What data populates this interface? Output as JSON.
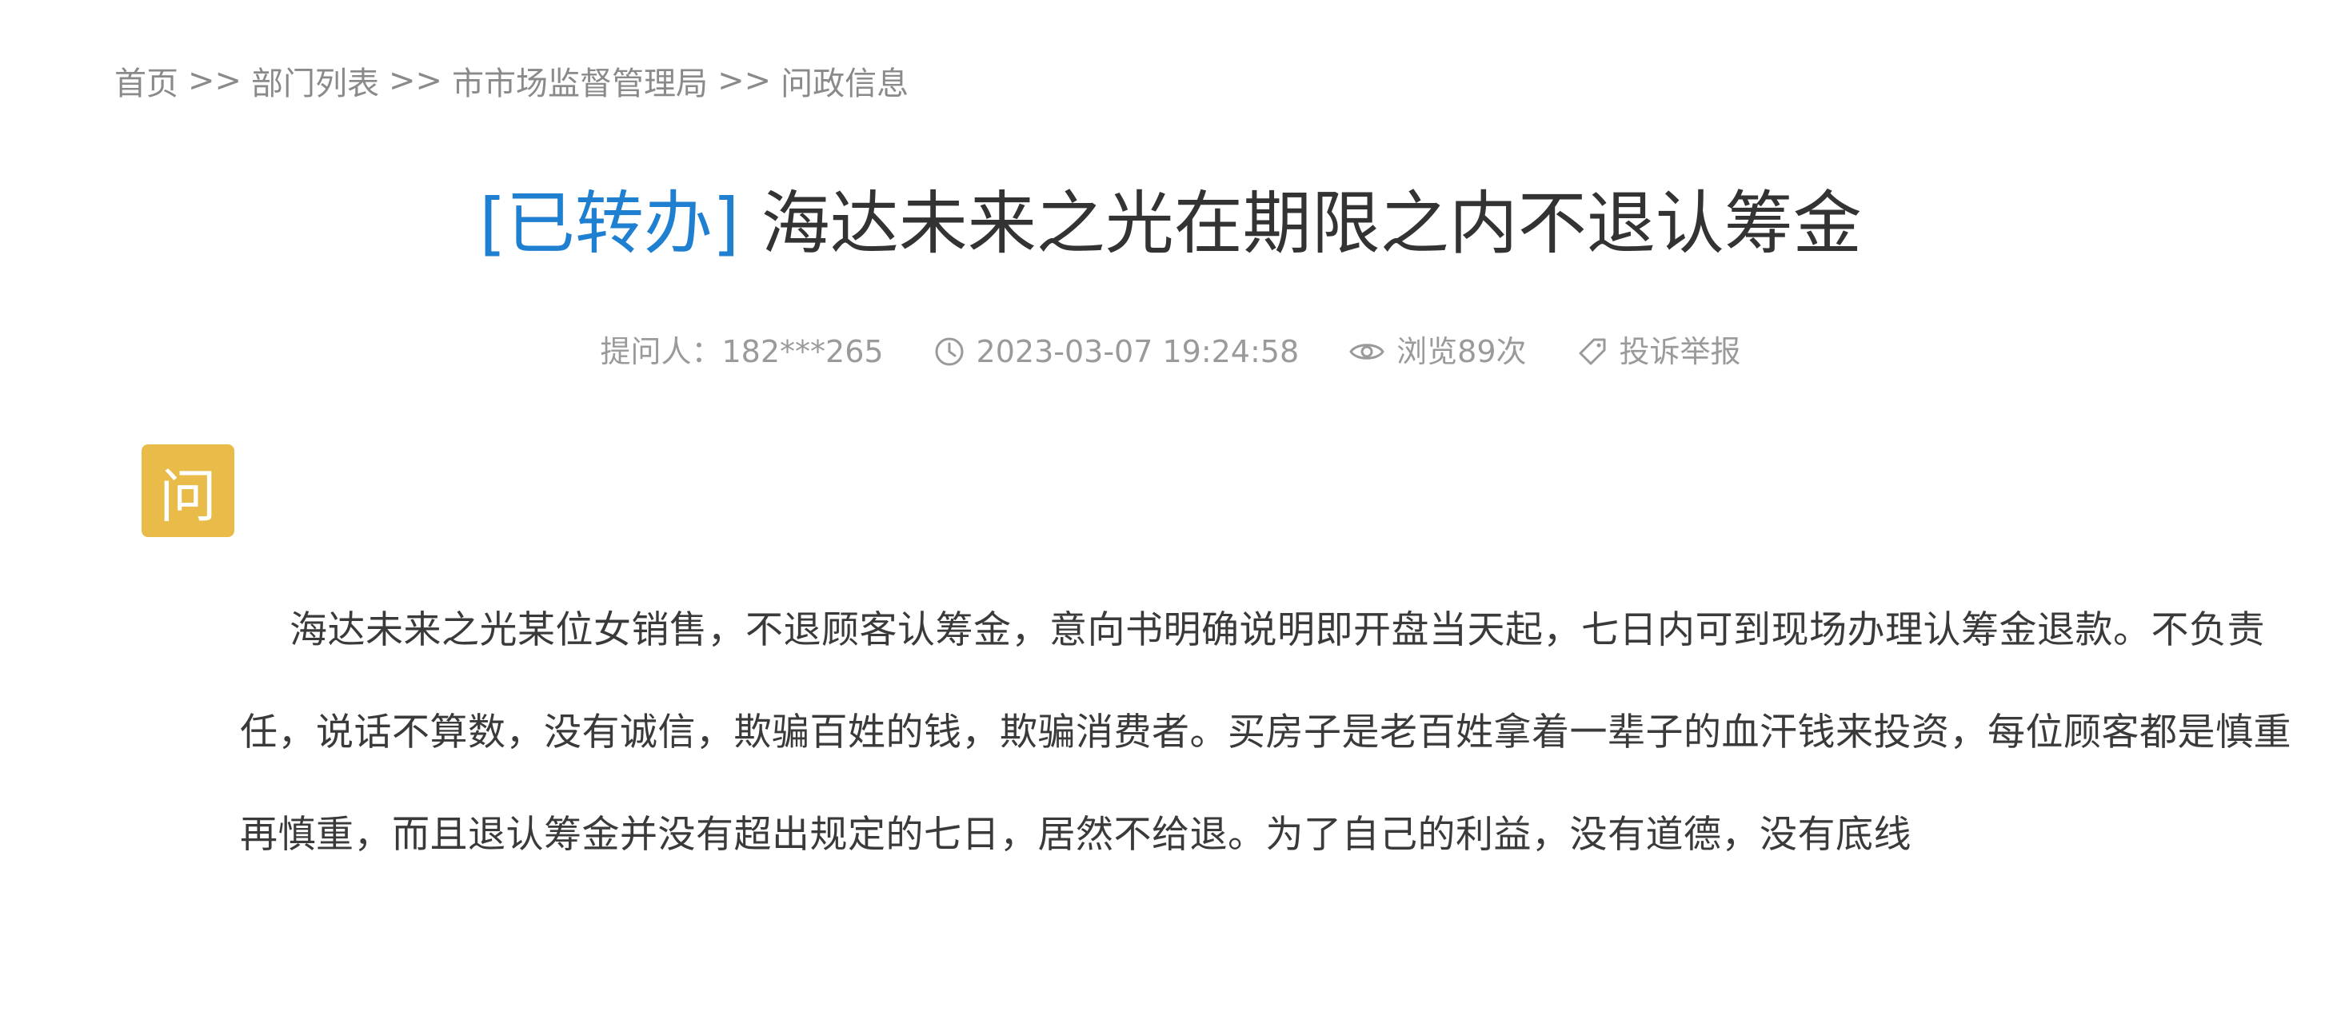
{
  "breadcrumb": {
    "items": [
      "首页",
      "部门列表",
      "市市场监督管理局",
      "问政信息"
    ],
    "separator": ">>"
  },
  "question": {
    "status": "[已转办]",
    "title": "海达未来之光在期限之内不退认筹金",
    "asker_label": "提问人：182***265",
    "datetime": "2023-03-07 19:24:58",
    "views": "浏览89次",
    "report_label": "投诉举报",
    "badge": "问",
    "content": "海达未来之光某位女销售，不退顾客认筹金，意向书明确说明即开盘当天起，七日内可到现场办理认筹金退款。不负责任，说话不算数，没有诚信，欺骗百姓的钱，欺骗消费者。买房子是老百姓拿着一辈子的血汗钱来投资，每位顾客都是慎重再慎重，而且退认筹金并没有超出规定的七日，居然不给退。为了自己的利益，没有道德，没有底线"
  },
  "colors": {
    "status_blue": "#1f7fd1",
    "badge_yellow": "#e9bc4a",
    "muted_text": "#9a9a9a",
    "body_text": "#3a3a3a"
  },
  "icons": [
    "clock-icon",
    "eye-icon",
    "tag-icon"
  ]
}
